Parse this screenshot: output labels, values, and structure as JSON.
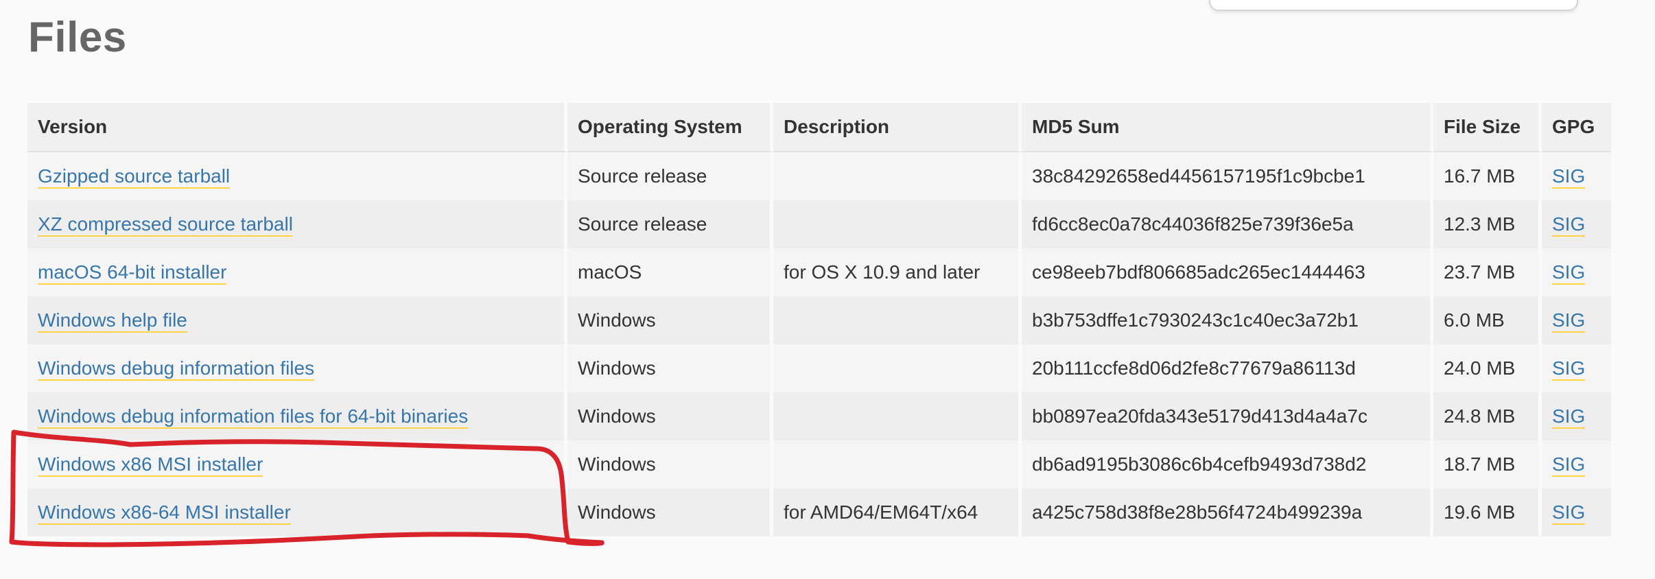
{
  "page": {
    "title": "Files"
  },
  "table": {
    "headers": [
      "Version",
      "Operating System",
      "Description",
      "MD5 Sum",
      "File Size",
      "GPG"
    ],
    "rows": [
      {
        "version": "Gzipped source tarball",
        "os": "Source release",
        "description": "",
        "md5": "38c84292658ed4456157195f1c9bcbe1",
        "size": "16.7 MB",
        "gpg": "SIG"
      },
      {
        "version": "XZ compressed source tarball",
        "os": "Source release",
        "description": "",
        "md5": "fd6cc8ec0a78c44036f825e739f36e5a",
        "size": "12.3 MB",
        "gpg": "SIG"
      },
      {
        "version": "macOS 64-bit installer",
        "os": "macOS",
        "description": "for OS X 10.9 and later",
        "md5": "ce98eeb7bdf806685adc265ec1444463",
        "size": "23.7 MB",
        "gpg": "SIG"
      },
      {
        "version": "Windows help file",
        "os": "Windows",
        "description": "",
        "md5": "b3b753dffe1c7930243c1c40ec3a72b1",
        "size": "6.0 MB",
        "gpg": "SIG"
      },
      {
        "version": "Windows debug information files",
        "os": "Windows",
        "description": "",
        "md5": "20b111ccfe8d06d2fe8c77679a86113d",
        "size": "24.0 MB",
        "gpg": "SIG"
      },
      {
        "version": "Windows debug information files for 64-bit binaries",
        "os": "Windows",
        "description": "",
        "md5": "bb0897ea20fda343e5179d413d4a4a7c",
        "size": "24.8 MB",
        "gpg": "SIG"
      },
      {
        "version": "Windows x86 MSI installer",
        "os": "Windows",
        "description": "",
        "md5": "db6ad9195b3086c6b4cefb9493d738d2",
        "size": "18.7 MB",
        "gpg": "SIG"
      },
      {
        "version": "Windows x86-64 MSI installer",
        "os": "Windows",
        "description": "for AMD64/EM64T/x64",
        "md5": "a425c758d38f8e28b56f4724b499239a",
        "size": "19.6 MB",
        "gpg": "SIG"
      }
    ]
  },
  "colors": {
    "link": "#3776ab",
    "link_underline": "#ffd343",
    "annotation": "#d8232a",
    "title": "#666666"
  }
}
